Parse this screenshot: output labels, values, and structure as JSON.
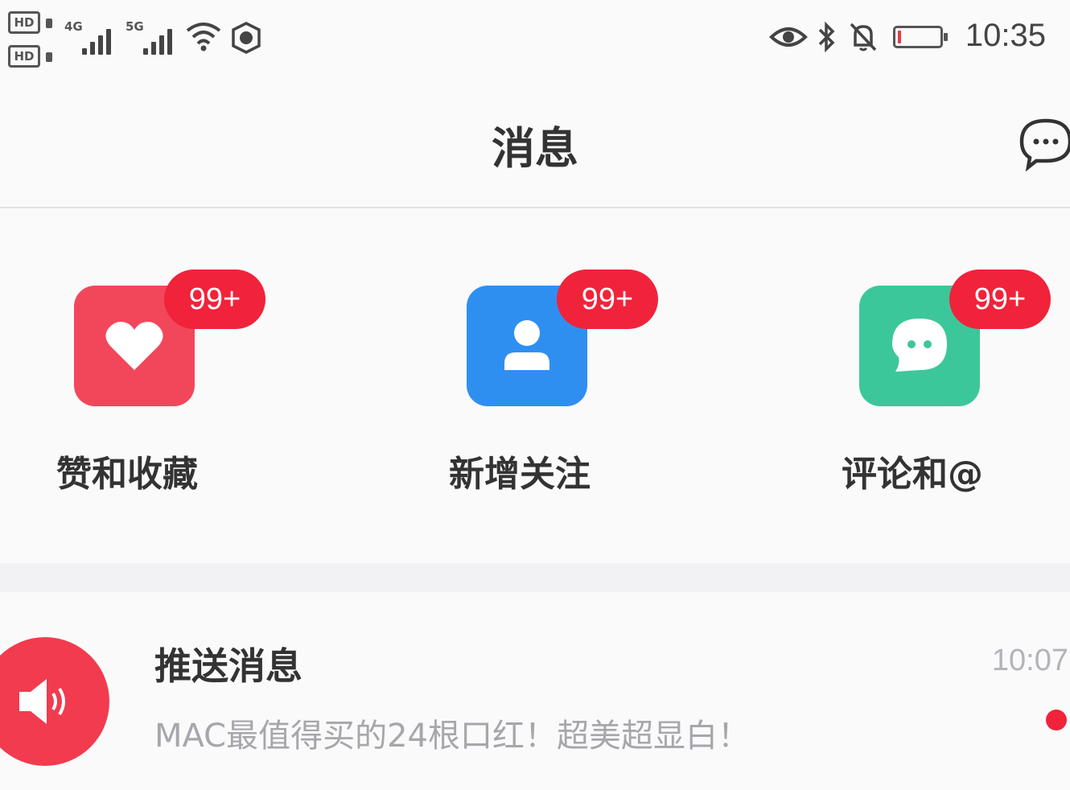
{
  "status_bar": {
    "hd_badges": [
      "HD",
      "HD"
    ],
    "signal_1": "4G",
    "signal_2": "5G",
    "time": "10:35",
    "icons": [
      "hd-icon",
      "signal-icon",
      "wifi-icon",
      "shield-app-icon",
      "eye-icon",
      "bluetooth-icon",
      "bell-off-icon",
      "battery-icon"
    ],
    "battery_level": 0.08,
    "battery_color": "#e63a4a"
  },
  "header": {
    "title": "消息",
    "chat_icon": "chat-bubble-icon"
  },
  "categories": [
    {
      "label": "赞和收藏",
      "badge": "99+",
      "icon": "heart-icon",
      "color": "#f2475b"
    },
    {
      "label": "新增关注",
      "badge": "99+",
      "icon": "person-icon",
      "color": "#2f8ff0"
    },
    {
      "label": "评论和@",
      "badge": "99+",
      "icon": "comment-icon",
      "color": "#3cc79a"
    }
  ],
  "badge_color": "#f0233a",
  "messages": [
    {
      "title": "推送消息",
      "preview": "MAC最值得买的24根口红！超美超显白！",
      "time": "10:07",
      "icon": "speaker-icon",
      "unread": true
    }
  ]
}
